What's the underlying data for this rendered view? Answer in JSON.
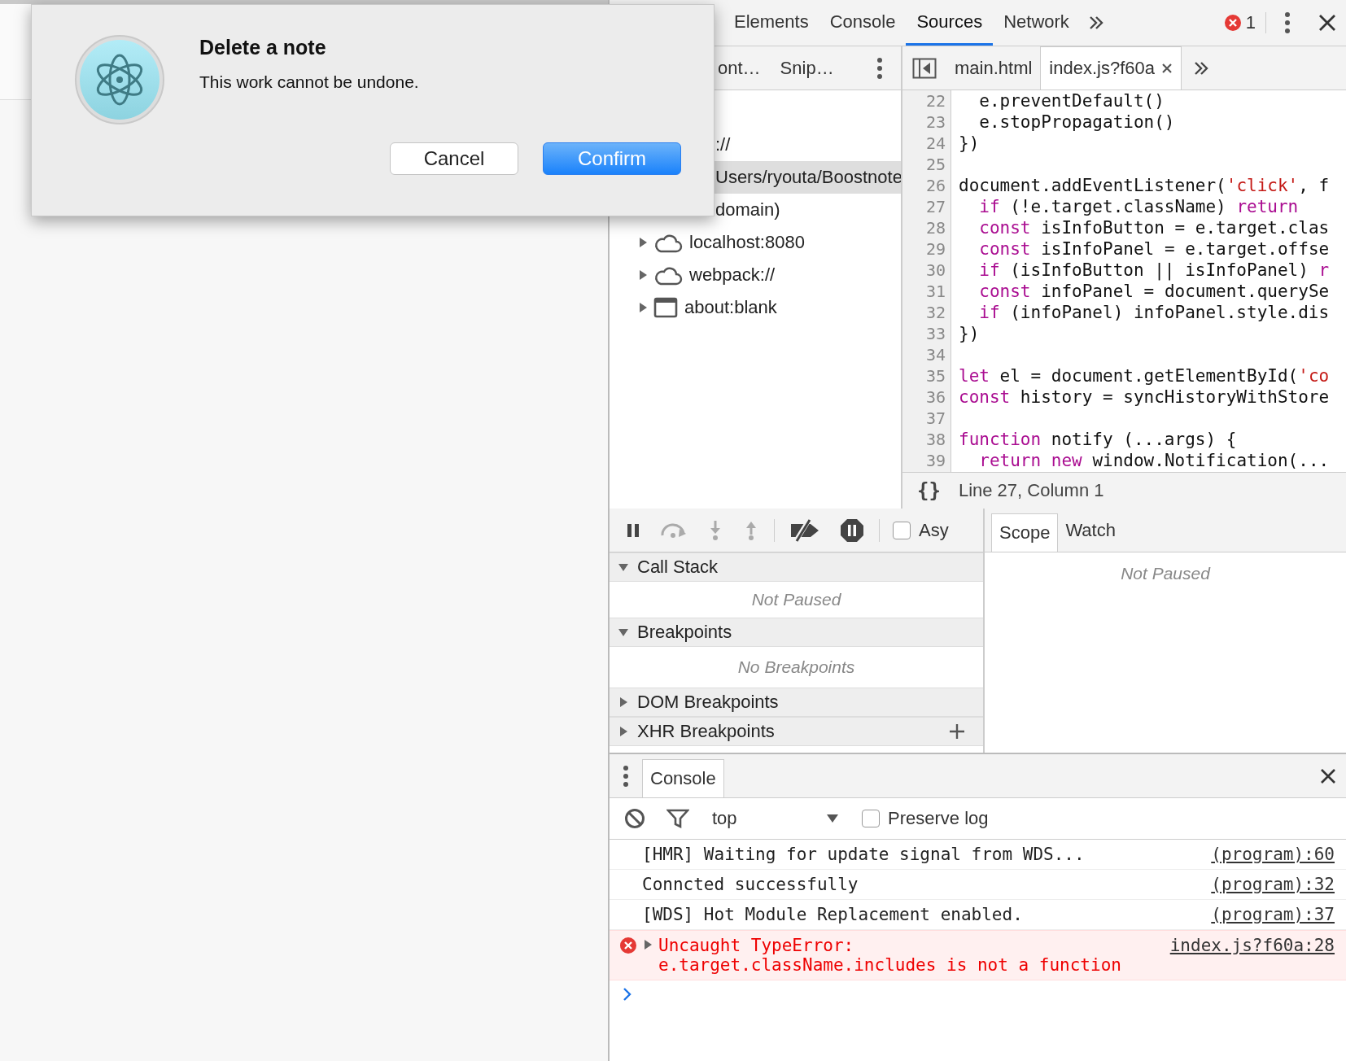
{
  "dialog": {
    "title": "Delete a note",
    "message": "This work cannot be undone.",
    "buttons": [
      {
        "label": "Cancel",
        "kind": "secondary"
      },
      {
        "label": "Confirm",
        "kind": "primary"
      }
    ]
  },
  "devtools": {
    "tabs": [
      {
        "label": "Elements",
        "selected": false
      },
      {
        "label": "Console",
        "selected": false
      },
      {
        "label": "Sources",
        "selected": true
      },
      {
        "label": "Network",
        "selected": false
      }
    ],
    "error_count": "1",
    "navigator": {
      "tabs": [
        "ont…",
        "Snip…"
      ],
      "items": [
        {
          "label": "://",
          "selected": false
        },
        {
          "label": "Users/ryouta/Boostnote",
          "selected": true
        },
        {
          "label": "domain)",
          "selected": false
        },
        {
          "label": "localhost:8080",
          "selected": false,
          "kind": "cloud"
        },
        {
          "label": "webpack://",
          "selected": false,
          "kind": "cloud"
        },
        {
          "label": "about:blank",
          "selected": false,
          "kind": "frame"
        }
      ]
    },
    "editor": {
      "tabs": [
        {
          "label": "main.html",
          "selected": false
        },
        {
          "label": "index.js?f60a",
          "selected": true
        }
      ],
      "lines": [
        {
          "number": "22",
          "tokens": [
            {
              "kind": "plain",
              "text": "  e.preventDefault()"
            }
          ]
        },
        {
          "number": "23",
          "tokens": [
            {
              "kind": "plain",
              "text": "  e.stopPropagation()"
            }
          ]
        },
        {
          "number": "24",
          "tokens": [
            {
              "kind": "plain",
              "text": "})"
            }
          ]
        },
        {
          "number": "25"
        },
        {
          "number": "26",
          "tokens": [
            {
              "kind": "plain",
              "text": "document.addEventListener("
            },
            {
              "kind": "string",
              "text": "'click'"
            },
            {
              "kind": "plain",
              "text": ", f"
            }
          ]
        },
        {
          "number": "27",
          "tokens": [
            {
              "kind": "keyword",
              "text": "  if"
            },
            {
              "kind": "plain",
              "text": " (!e.target.className) "
            },
            {
              "kind": "keyword",
              "text": "return"
            }
          ]
        },
        {
          "number": "28",
          "tokens": [
            {
              "kind": "keyword",
              "text": "  const"
            },
            {
              "kind": "plain",
              "text": " isInfoButton = e.target.clas"
            }
          ]
        },
        {
          "number": "29",
          "tokens": [
            {
              "kind": "keyword",
              "text": "  const"
            },
            {
              "kind": "plain",
              "text": " isInfoPanel = e.target.offse"
            }
          ]
        },
        {
          "number": "30",
          "tokens": [
            {
              "kind": "keyword",
              "text": "  if"
            },
            {
              "kind": "plain",
              "text": " (isInfoButton || isInfoPanel) "
            },
            {
              "kind": "keyword",
              "text": "r"
            }
          ]
        },
        {
          "number": "31",
          "tokens": [
            {
              "kind": "keyword",
              "text": "  const"
            },
            {
              "kind": "plain",
              "text": " infoPanel = document.querySe"
            }
          ]
        },
        {
          "number": "32",
          "tokens": [
            {
              "kind": "keyword",
              "text": "  if"
            },
            {
              "kind": "plain",
              "text": " (infoPanel) infoPanel.style.dis"
            }
          ]
        },
        {
          "number": "33",
          "tokens": [
            {
              "kind": "plain",
              "text": "})"
            }
          ]
        },
        {
          "number": "34"
        },
        {
          "number": "35",
          "tokens": [
            {
              "kind": "keyword",
              "text": "let"
            },
            {
              "kind": "plain",
              "text": " el = document.getElementById("
            },
            {
              "kind": "string",
              "text": "'co"
            }
          ]
        },
        {
          "number": "36",
          "tokens": [
            {
              "kind": "keyword",
              "text": "const"
            },
            {
              "kind": "plain",
              "text": " history = syncHistoryWithStore"
            }
          ]
        },
        {
          "number": "37"
        },
        {
          "number": "38",
          "tokens": [
            {
              "kind": "keyword",
              "text": "function"
            },
            {
              "kind": "plain",
              "text": " notify (...args) {"
            }
          ]
        },
        {
          "number": "39",
          "tokens": [
            {
              "kind": "keyword",
              "text": "  return"
            },
            {
              "kind": "keyword",
              "text": " new"
            },
            {
              "kind": "plain",
              "text": " window.Notification(..."
            }
          ]
        }
      ],
      "format_button": "{}",
      "status": "Line 27, Column 1"
    },
    "debugger": {
      "async": {
        "label": "Asy",
        "checked": false
      },
      "sections": [
        {
          "title": "Call Stack",
          "expanded": true,
          "empty_text": "Not Paused"
        },
        {
          "title": "Breakpoints",
          "expanded": true,
          "empty_text": "No Breakpoints"
        },
        {
          "title": "DOM Breakpoints",
          "expanded": false
        },
        {
          "title": "XHR Breakpoints",
          "expanded": false,
          "addable": true
        }
      ],
      "sidebar_tabs": [
        {
          "label": "Scope",
          "selected": true
        },
        {
          "label": "Watch",
          "selected": false
        }
      ],
      "scope_text": "Not Paused"
    },
    "drawer": {
      "tab": {
        "label": "Console",
        "selected": true
      },
      "context": "top",
      "preserve_log": {
        "label": "Preserve log",
        "checked": false
      },
      "messages": [
        {
          "kind": "log",
          "text": "[HMR] Waiting for update signal from WDS...",
          "source": "(program):60"
        },
        {
          "kind": "log",
          "text": "Conncted successfully",
          "source": "(program):32"
        },
        {
          "kind": "log",
          "text": "[WDS] Hot Module Replacement enabled.",
          "source": "(program):37"
        },
        {
          "kind": "error",
          "text": "Uncaught TypeError:\ne.target.className.includes is not a function",
          "source": "index.js?f60a:28"
        }
      ]
    }
  }
}
